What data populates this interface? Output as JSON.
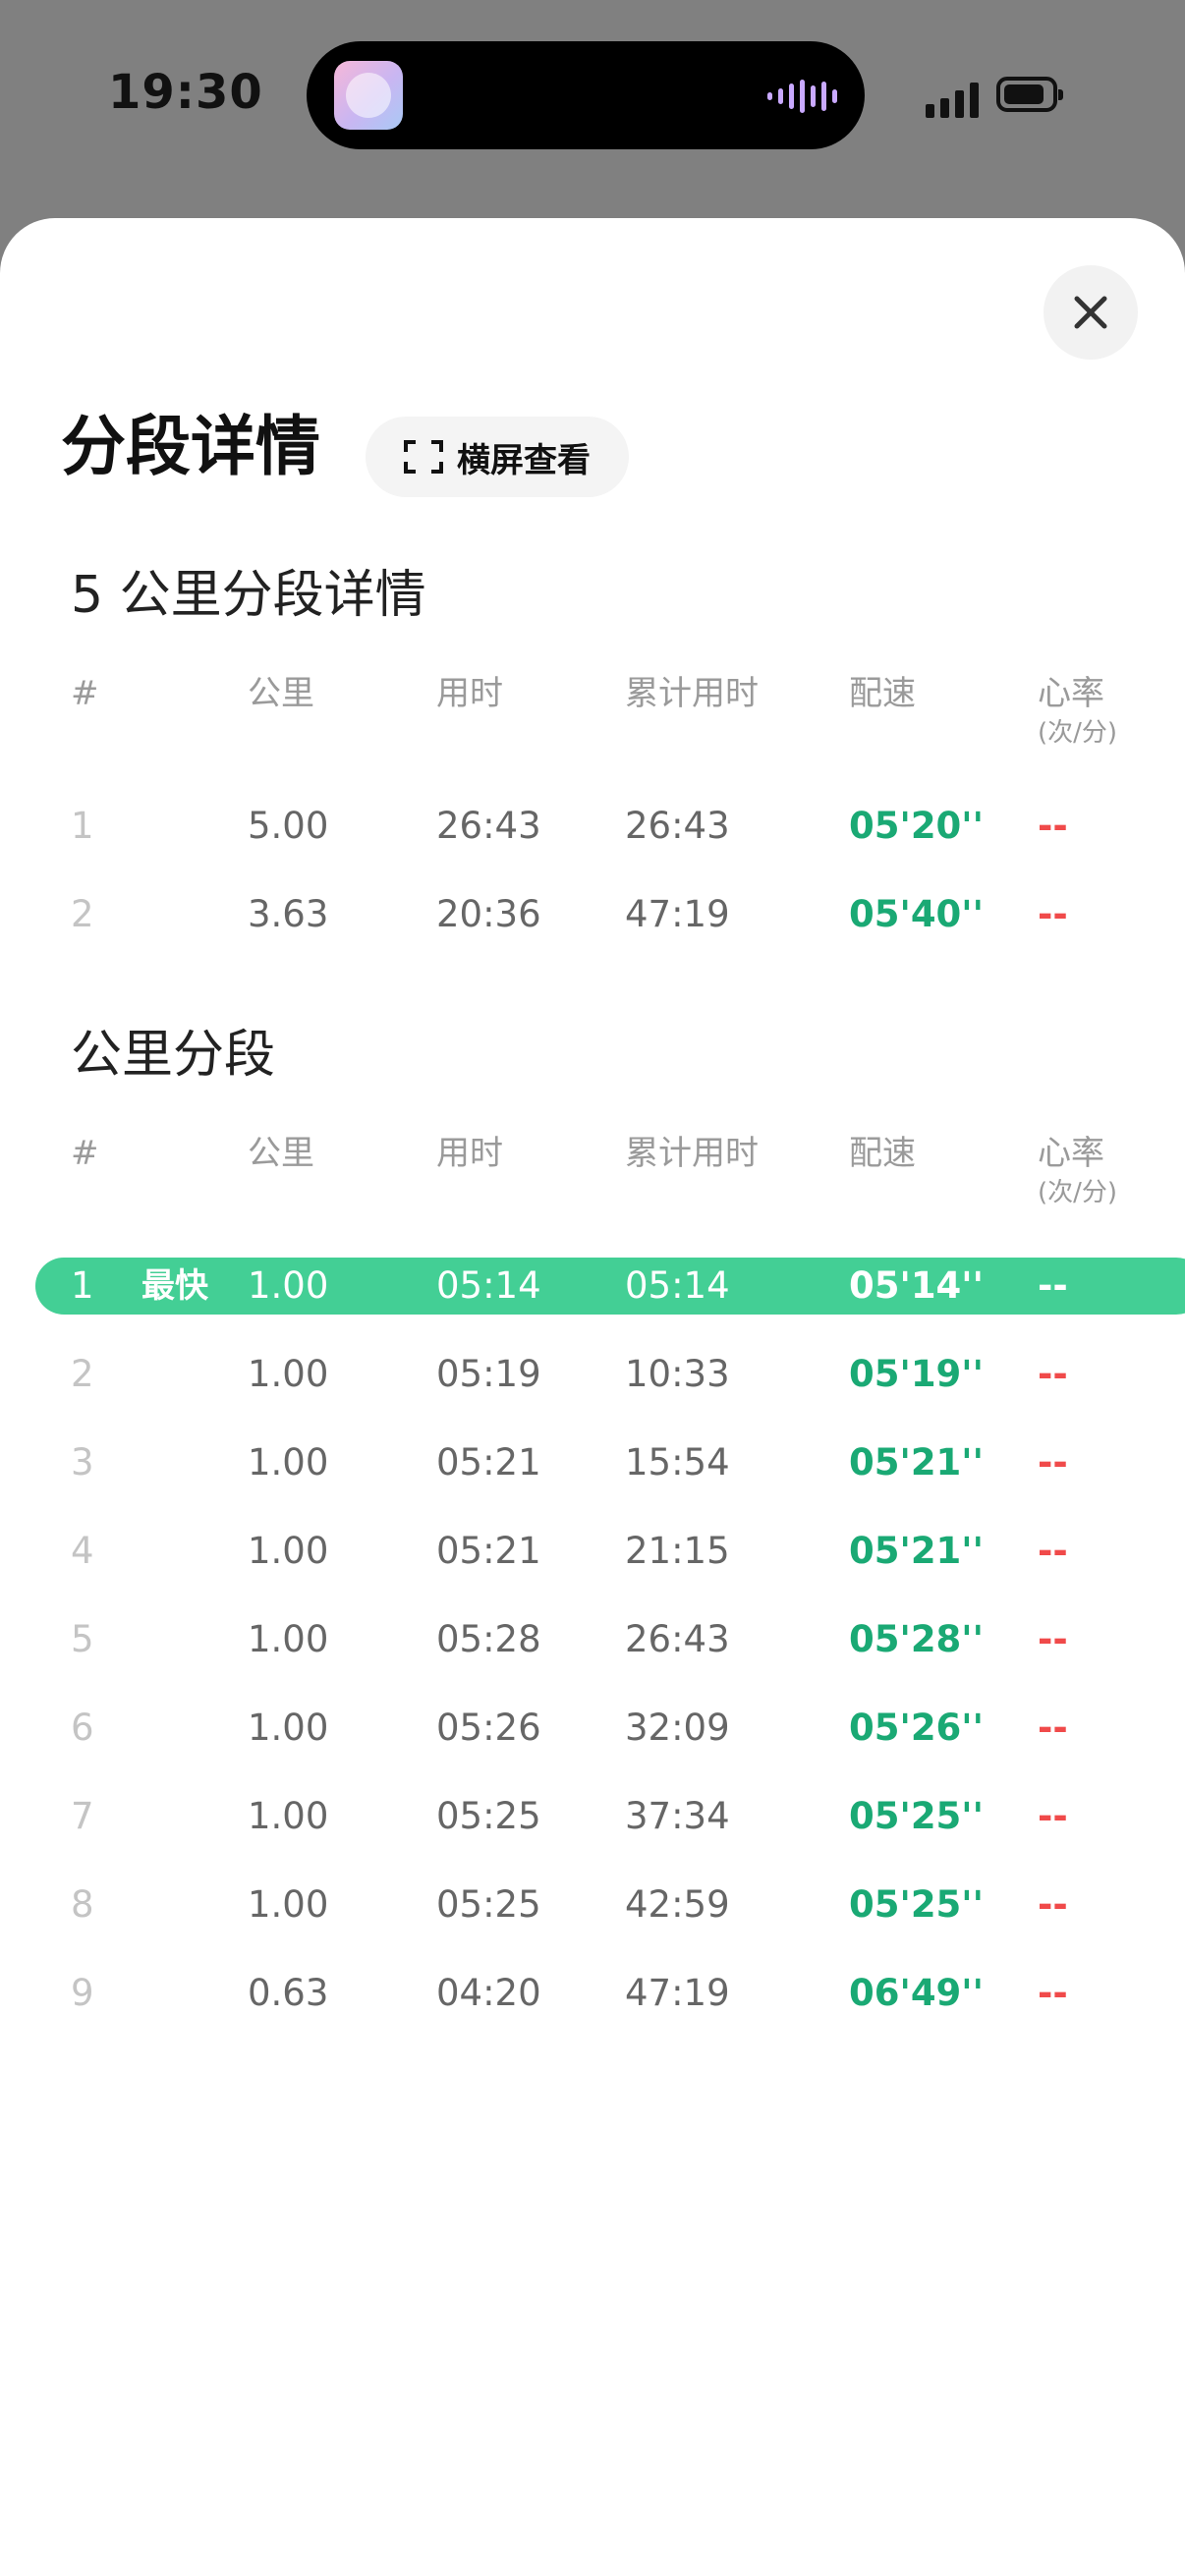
{
  "status_bar": {
    "time": "19:30"
  },
  "header": {
    "title": "分段详情",
    "landscape_label": "横屏查看"
  },
  "columns": {
    "index": "#",
    "km": "公里",
    "time": "用时",
    "cumulative": "累计用时",
    "pace": "配速",
    "hr": "心率",
    "hr_unit": "(次/分)"
  },
  "section_5km": {
    "title": "5 公里分段详情",
    "rows": [
      {
        "idx": "1",
        "km": "5.00",
        "time": "26:43",
        "cum": "26:43",
        "pace": "05'20''",
        "hr": "--"
      },
      {
        "idx": "2",
        "km": "3.63",
        "time": "20:36",
        "cum": "47:19",
        "pace": "05'40''",
        "hr": "--"
      }
    ]
  },
  "section_km": {
    "title": "公里分段",
    "fastest_label": "最快",
    "rows": [
      {
        "idx": "1",
        "km": "1.00",
        "time": "05:14",
        "cum": "05:14",
        "pace": "05'14''",
        "hr": "--"
      },
      {
        "idx": "2",
        "km": "1.00",
        "time": "05:19",
        "cum": "10:33",
        "pace": "05'19''",
        "hr": "--"
      },
      {
        "idx": "3",
        "km": "1.00",
        "time": "05:21",
        "cum": "15:54",
        "pace": "05'21''",
        "hr": "--"
      },
      {
        "idx": "4",
        "km": "1.00",
        "time": "05:21",
        "cum": "21:15",
        "pace": "05'21''",
        "hr": "--"
      },
      {
        "idx": "5",
        "km": "1.00",
        "time": "05:28",
        "cum": "26:43",
        "pace": "05'28''",
        "hr": "--"
      },
      {
        "idx": "6",
        "km": "1.00",
        "time": "05:26",
        "cum": "32:09",
        "pace": "05'26''",
        "hr": "--"
      },
      {
        "idx": "7",
        "km": "1.00",
        "time": "05:25",
        "cum": "37:34",
        "pace": "05'25''",
        "hr": "--"
      },
      {
        "idx": "8",
        "km": "1.00",
        "time": "05:25",
        "cum": "42:59",
        "pace": "05'25''",
        "hr": "--"
      },
      {
        "idx": "9",
        "km": "0.63",
        "time": "04:20",
        "cum": "47:19",
        "pace": "06'49''",
        "hr": "--"
      }
    ]
  },
  "colors": {
    "pace": "#1aa974",
    "heart_rate": "#f04a4a",
    "fastest_row": "#43cf95"
  }
}
